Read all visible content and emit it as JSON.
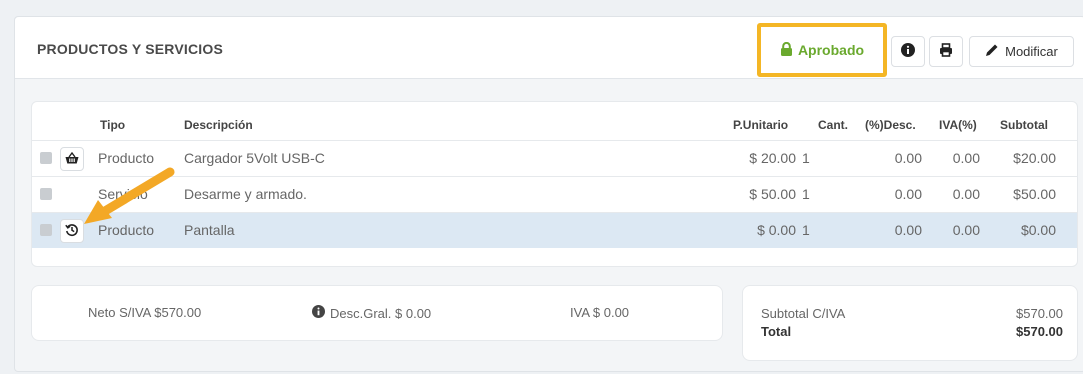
{
  "header": {
    "title": "PRODUCTOS Y SERVICIOS",
    "status_label": "Aprobado",
    "edit_label": "Modificar"
  },
  "colors": {
    "approved_green": "#6aa92e",
    "highlight_orange": "#f4b625",
    "arrow_orange": "#f3a826",
    "selected_row": "#dce8f3"
  },
  "table": {
    "headers": {
      "tipo": "Tipo",
      "descripcion": "Descripción",
      "punitario": "P.Unitario",
      "cant": "Cant.",
      "desc": "(%)Desc.",
      "iva": "IVA(%)",
      "subtotal": "Subtotal"
    },
    "rows": [
      {
        "tipo": "Producto",
        "descripcion": "Cargador 5Volt USB-C",
        "punitario": "$ 20.00",
        "cant": "1",
        "desc": "0.00",
        "iva": "0.00",
        "subtotal": "$20.00",
        "action_icon": "basket-icon"
      },
      {
        "tipo": "Servicio",
        "descripcion": "Desarme y armado.",
        "punitario": "$ 50.00",
        "cant": "1",
        "desc": "0.00",
        "iva": "0.00",
        "subtotal": "$50.00",
        "action_icon": ""
      },
      {
        "tipo": "Producto",
        "descripcion": "Pantalla",
        "punitario": "$ 0.00",
        "cant": "1",
        "desc": "0.00",
        "iva": "0.00",
        "subtotal": "$0.00",
        "action_icon": "history-icon",
        "selected": true
      }
    ]
  },
  "totals": {
    "neto": "Neto S/IVA $570.00",
    "desc_gral": "Desc.Gral. $ 0.00",
    "iva": "IVA $ 0.00",
    "subtotal_label": "Subtotal C/IVA",
    "subtotal_value": "$570.00",
    "total_label": "Total",
    "total_value": "$570.00"
  }
}
